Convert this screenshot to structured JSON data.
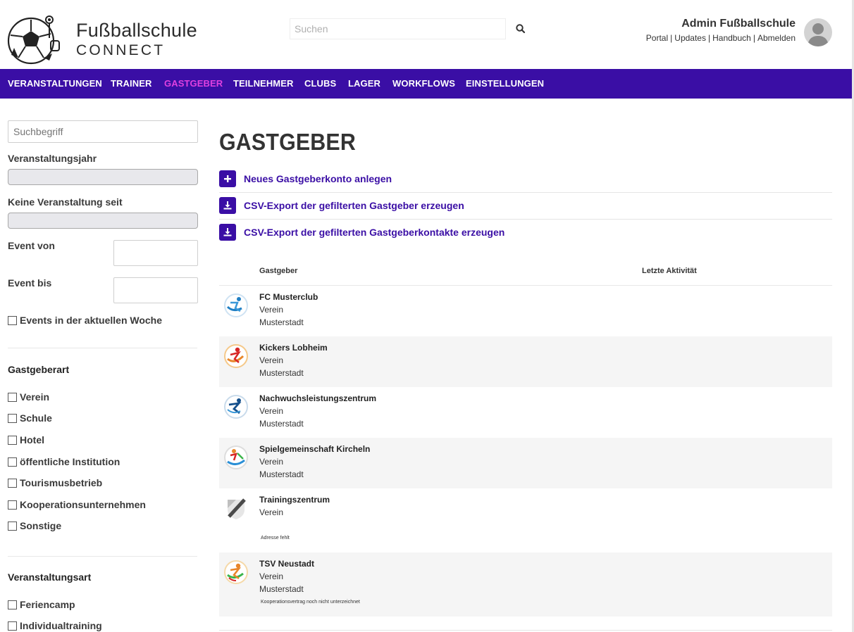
{
  "brand": {
    "line1": "Fußballschule",
    "line2": "CONNECT"
  },
  "search": {
    "placeholder": "Suchen"
  },
  "user": {
    "name": "Admin Fußballschule",
    "links": [
      "Portal",
      "Updates",
      "Handbuch",
      "Abmelden"
    ]
  },
  "nav": {
    "items": [
      "VERANSTALTUNGEN",
      "TRAINER",
      "GASTGEBER",
      "TEILNEHMER",
      "CLUBS",
      "LAGER",
      "WORKFLOWS",
      "EINSTELLUNGEN"
    ],
    "active": "GASTGEBER"
  },
  "colors": {
    "primary": "#3a0ea5",
    "active_nav": "#e040e0"
  },
  "sidebar": {
    "search_placeholder": "Suchbegriff",
    "year_label": "Veranstaltungsjahr",
    "no_event_label": "Keine Veranstaltung seit",
    "event_from_label": "Event von",
    "event_to_label": "Event bis",
    "current_week_label": "Events in der aktuellen Woche",
    "host_type_heading": "Gastgeberart",
    "host_types": [
      "Verein",
      "Schule",
      "Hotel",
      "öffentliche Institution",
      "Tourismusbetrieb",
      "Kooperationsunternehmen",
      "Sonstige"
    ],
    "event_type_heading": "Veranstaltungsart",
    "event_types": [
      "Feriencamp",
      "Individualtraining"
    ]
  },
  "main": {
    "title": "GASTGEBER",
    "actions": [
      {
        "label": "Neues Gastgeberkonto anlegen",
        "icon": "plus-icon"
      },
      {
        "label": "CSV-Export der gefilterten Gastgeber erzeugen",
        "icon": "download-icon"
      },
      {
        "label": "CSV-Export der gefilterten Gastgeberkontakte erzeugen",
        "icon": "download-icon"
      }
    ],
    "columns": [
      "Gastgeber",
      "Letzte Aktivität"
    ],
    "rows": [
      {
        "name": "FC Musterclub",
        "type": "Verein",
        "city": "Musterstadt",
        "note": ""
      },
      {
        "name": "Kickers Lobheim",
        "type": "Verein",
        "city": "Musterstadt",
        "note": ""
      },
      {
        "name": "Nachwuchsleistungszentrum",
        "type": "Verein",
        "city": "Musterstadt",
        "note": ""
      },
      {
        "name": "Spielgemeinschaft Kircheln",
        "type": "Verein",
        "city": "Musterstadt",
        "note": ""
      },
      {
        "name": "Trainingszentrum",
        "type": "Verein",
        "city": "",
        "note": "Adresse fehlt"
      },
      {
        "name": "TSV Neustadt",
        "type": "Verein",
        "city": "Musterstadt",
        "note": "Kooperationsvertrag noch nicht unterzeichnet"
      }
    ]
  }
}
